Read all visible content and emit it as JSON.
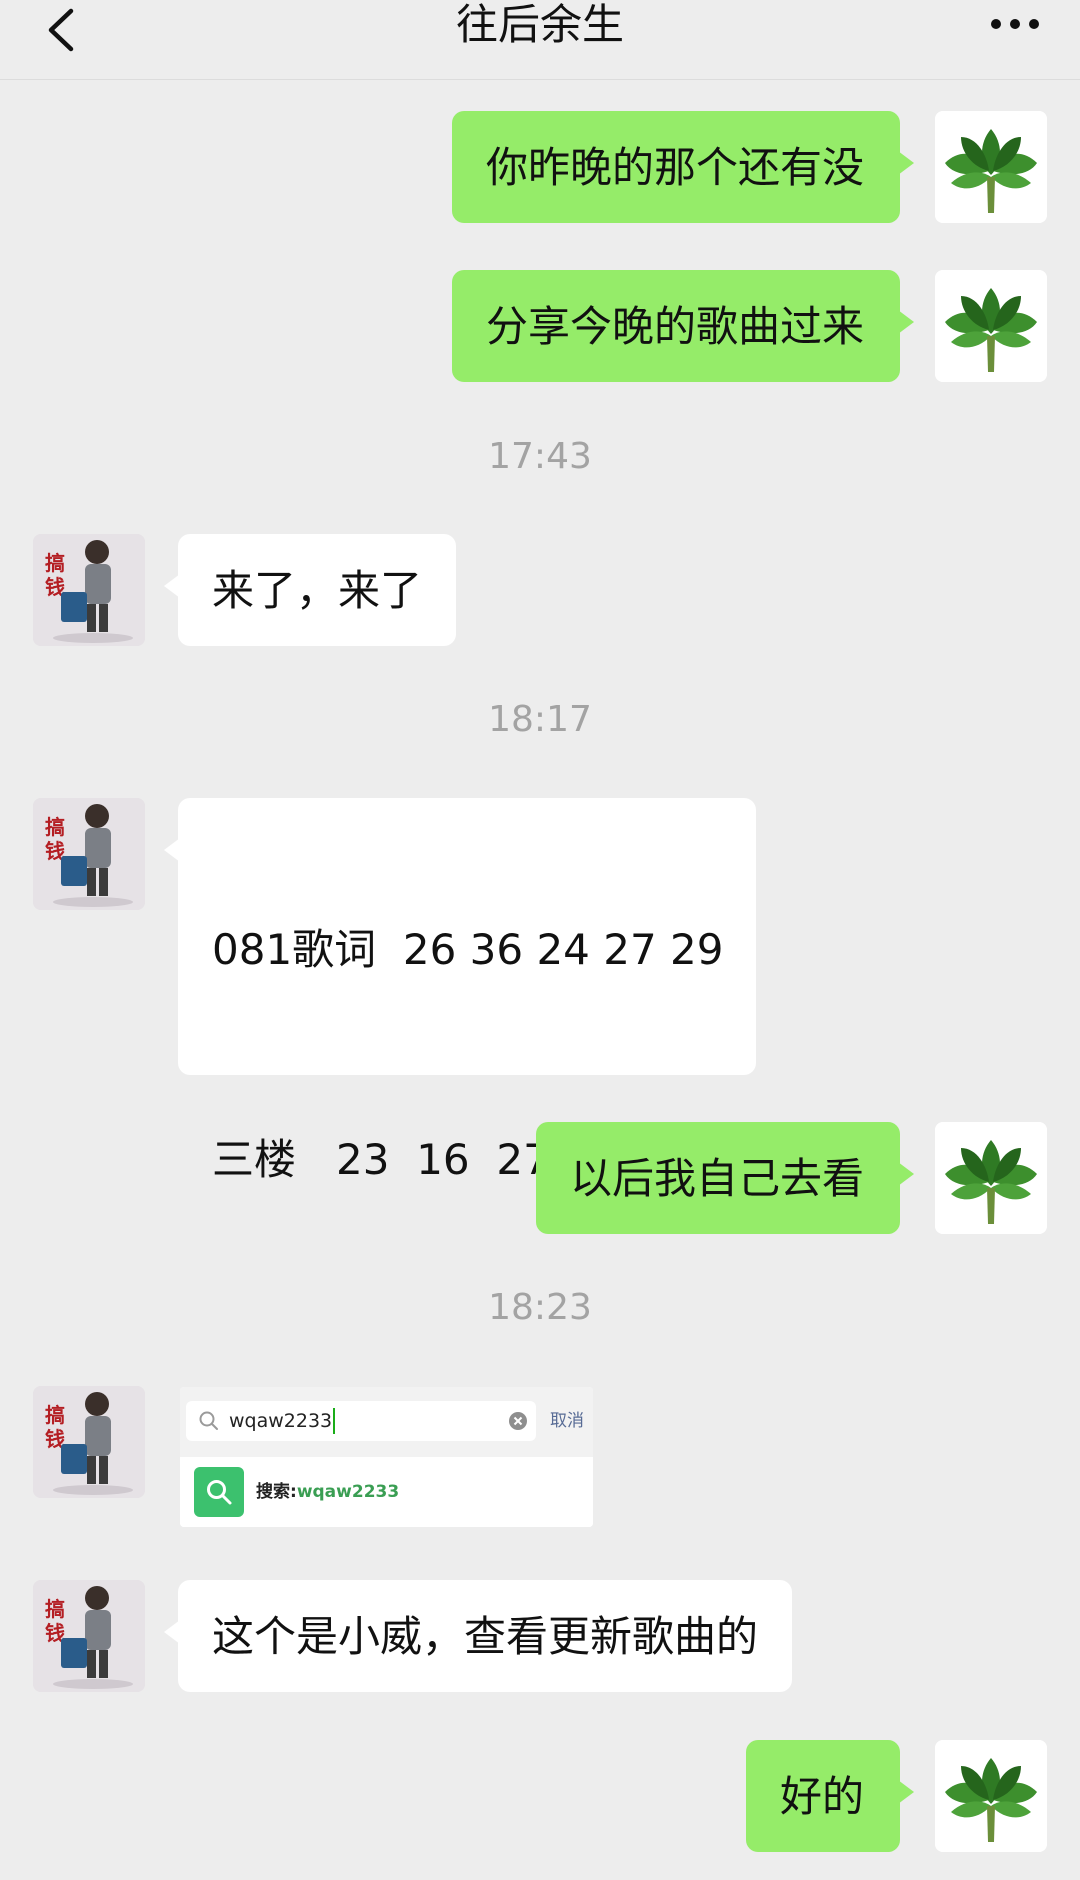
{
  "header": {
    "title": "往后余生",
    "back_icon": "chevron-left-icon",
    "more_icon": "more-dots-icon"
  },
  "messages": [
    {
      "from": "self",
      "text": "你昨晚的那个还有没"
    },
    {
      "from": "self",
      "text": "分享今晚的歌曲过来"
    },
    {
      "type": "time",
      "text": "17:43"
    },
    {
      "from": "other",
      "text": "来了，来了"
    },
    {
      "type": "time",
      "text": "18:17"
    },
    {
      "from": "other",
      "lines": [
        "081歌词  26 36 24 27 29",
        "三楼   23  16  27"
      ]
    },
    {
      "from": "self",
      "text": "以后我自己去看"
    },
    {
      "type": "time",
      "text": "18:23"
    },
    {
      "from": "other",
      "type": "image",
      "image": {
        "search_value": "wqaw2233",
        "cancel_label": "取消",
        "result_label": "搜索:",
        "result_value": "wqaw2233"
      }
    },
    {
      "from": "other",
      "text": "这个是小威，查看更新歌曲的"
    },
    {
      "from": "self",
      "text": "好的"
    }
  ],
  "colors": {
    "background": "#ededed",
    "self_bubble": "#95ec69",
    "other_bubble": "#ffffff",
    "timestamp": "#a3a3a3"
  }
}
